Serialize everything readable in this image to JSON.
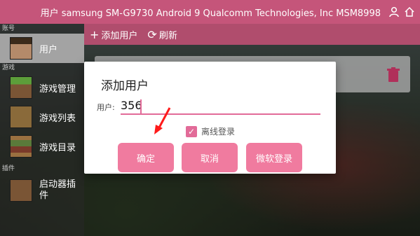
{
  "device": {
    "title": "用户  samsung SM-G9730 Android 9  Qualcomm Technologies, Inc MSM8998"
  },
  "toolbar": {
    "add_user": "添加用户",
    "refresh": "刷新"
  },
  "sidebar": {
    "sections": [
      "账号",
      "游戏",
      "插件"
    ],
    "items": [
      {
        "label": "用户"
      },
      {
        "label": "游戏管理"
      },
      {
        "label": "游戏列表"
      },
      {
        "label": "游戏目录"
      },
      {
        "label": "启动器插件"
      }
    ]
  },
  "dialog": {
    "title": "添加用户",
    "username_label": "用户:",
    "username_value": "356",
    "offline_label": "离线登录",
    "offline_checked": true,
    "buttons": {
      "confirm": "确定",
      "cancel": "取消",
      "microsoft_login": "微软登录"
    }
  },
  "colors": {
    "topbar": "#c5557a",
    "accent": "#e26b98",
    "button": "#f07b9f"
  },
  "icons": [
    "account-icon",
    "home-icon",
    "plus-icon",
    "refresh-icon",
    "trash-icon",
    "check-icon"
  ]
}
